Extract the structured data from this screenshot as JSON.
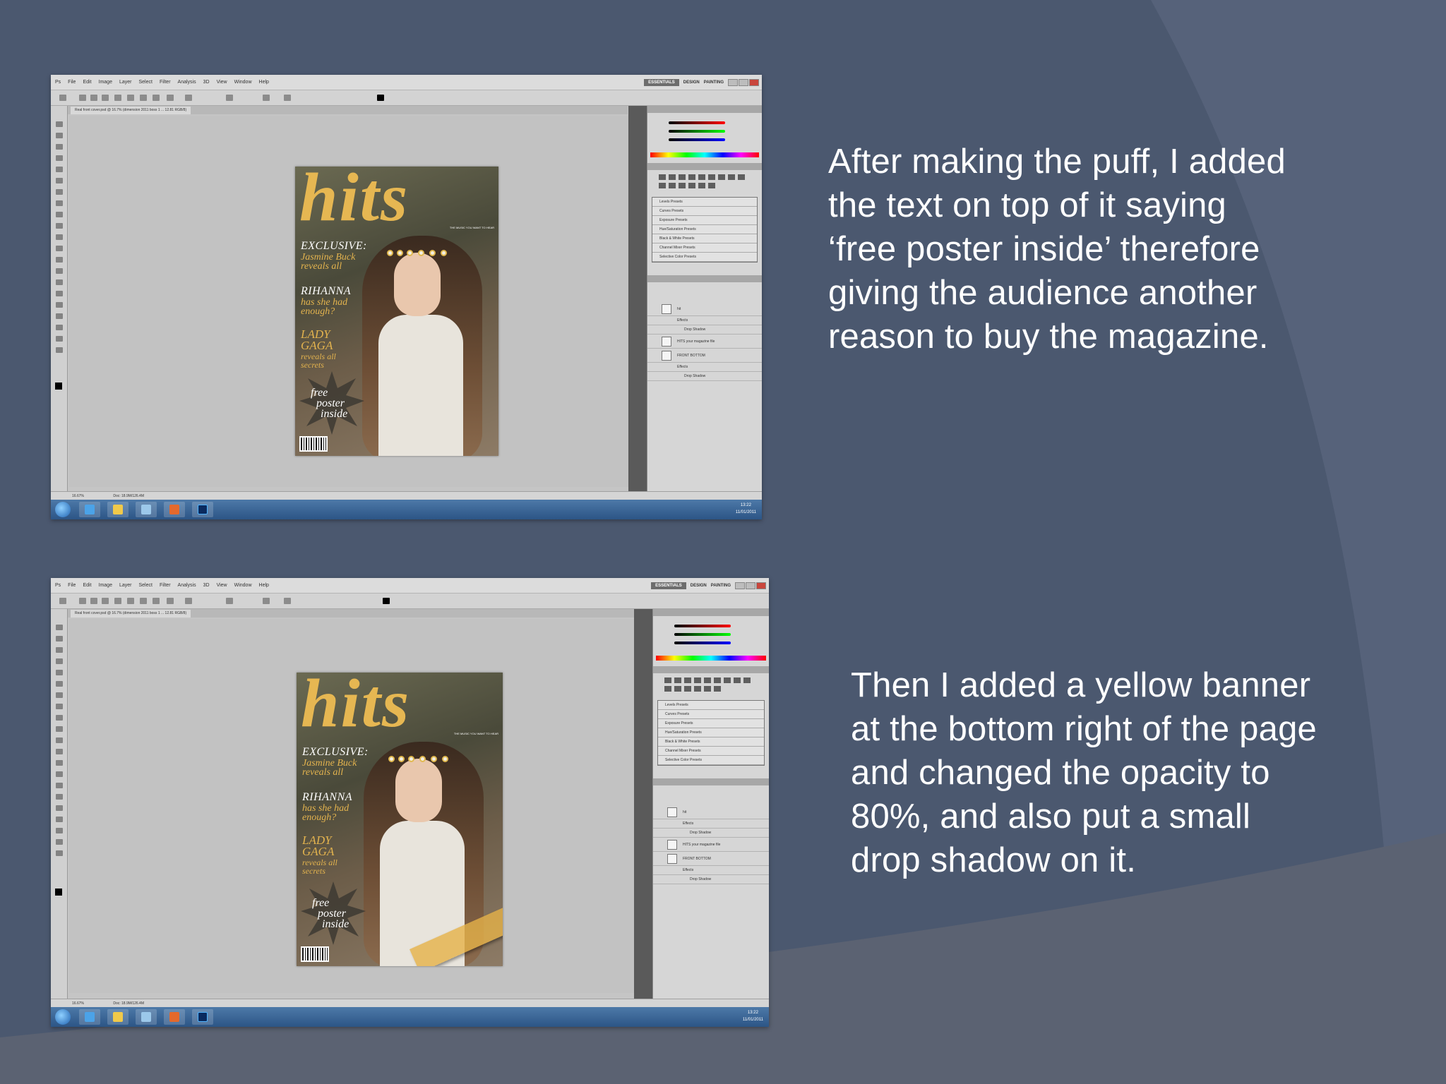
{
  "slide": {
    "caption_top": [
      "After making the puff, I added",
      "the text on top of it saying",
      "‘free poster inside’ therefore",
      "giving the audience another",
      "reason to buy the magazine."
    ],
    "caption_bottom": [
      "Then I added a yellow banner",
      "at the bottom right of the page",
      "and changed the opacity to",
      "80%, and also put a small",
      "drop shadow on it."
    ]
  },
  "photoshop": {
    "menu": [
      "Ps",
      "File",
      "Edit",
      "Image",
      "Layer",
      "Select",
      "Filter",
      "Analysis",
      "3D",
      "View",
      "Window",
      "Help"
    ],
    "workspaces": [
      "ESSENTIALS",
      "DESIGN",
      "PAINTING"
    ],
    "doc_tab": "Real front cover.psd @ 16.7% (dimension 2011 boss 1 ... 12.81 RGB/8)",
    "adjustment_presets": [
      "Levels Presets",
      "Curves Presets",
      "Exposure Presets",
      "Hue/Saturation Presets",
      "Black & White Presets",
      "Channel Mixer Presets",
      "Selective Color Presets"
    ],
    "layers": [
      "hit",
      "Effects",
      "Drop Shadow",
      "HITS your magazine file",
      "FRONT BOTTOM",
      "Effects",
      "Drop Shadow"
    ],
    "status": "16.67%",
    "doc_size": "Doc: 18.9M/126.4M",
    "clock_time": "13:22",
    "clock_date": "11/01/2011"
  },
  "cover": {
    "title": "hits",
    "exclusive": "EXCLUSIVE:",
    "exclusive_sub1": "Jasmine Buck",
    "exclusive_sub2": "reveals all",
    "rihanna": "RIHANNA",
    "rihanna_sub1": "has she had",
    "rihanna_sub2": "enough?",
    "lady": "LADY",
    "gaga": "GAGA",
    "gaga_sub1": "reveals all",
    "gaga_sub2": "secrets",
    "puff1": "free",
    "puff2": "poster",
    "puff3": "inside",
    "tagline": "THE MUSIC YOU WANT TO HEAR"
  },
  "colors": {
    "background": "#4b586f",
    "title_gold": "#e6b752",
    "banner_yellow": "#e5b248"
  }
}
